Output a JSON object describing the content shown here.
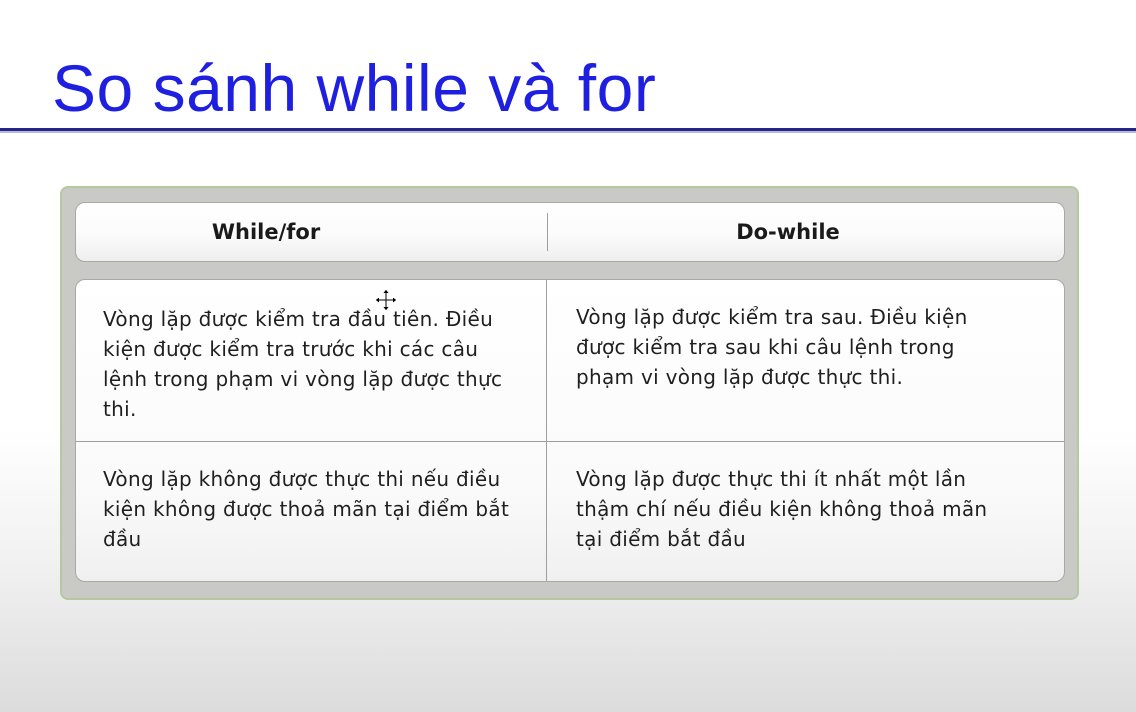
{
  "slide": {
    "title": "So sánh while và for"
  },
  "table": {
    "headers": [
      "While/for",
      "Do-while"
    ],
    "rows": [
      [
        "Vòng lặp được kiểm tra đầu tiên. Điều kiện được kiểm tra trước khi các câu lệnh trong phạm vi vòng lặp được thực thi.",
        "Vòng lặp được kiểm tra sau. Điều kiện được kiểm tra sau khi câu lệnh trong phạm vi vòng lặp được thực thi."
      ],
      [
        "Vòng lặp không được thực thi nếu điều kiện không được thoả mãn tại điểm bắt đầu",
        "Vòng lặp được thực thi ít nhất một lần thậm chí nếu điều kiện không thoả mãn tại điểm bắt đầu"
      ]
    ]
  },
  "colors": {
    "title": "#1f1fe0",
    "rule": "#24248a",
    "frame": "#c9c9c6"
  },
  "icons": {
    "cursor": "move-cursor-icon"
  }
}
